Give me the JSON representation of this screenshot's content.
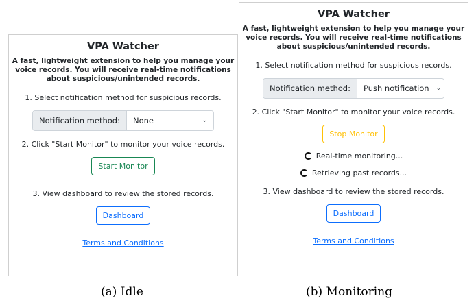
{
  "panels": [
    {
      "title": "VPA Watcher",
      "description": "A fast, lightweight extension to help you manage your voice records. You will receive real-time notifications about suspicious/unintended records.",
      "step1": "1. Select notification method for suspicious records.",
      "select_label": "Notification method:",
      "select_value": "None",
      "step2": "2. Click \"Start Monitor\" to monitor your voice records.",
      "monitor_button": "Start Monitor",
      "step3": "3. View dashboard to review the stored records.",
      "dashboard_button": "Dashboard",
      "terms_link": "Terms and Conditions",
      "caption": "(a) Idle"
    },
    {
      "title": "VPA Watcher",
      "description": "A fast, lightweight extension to help you manage your voice records. You will receive real-time notifications about suspicious/unintended records.",
      "step1": "1. Select notification method for suspicious records.",
      "select_label": "Notification method:",
      "select_value": "Push notification",
      "step2": "2. Click \"Start Monitor\" to monitor your voice records.",
      "monitor_button": "Stop Monitor",
      "status_realtime": "Real-time monitoring...",
      "status_past": "Retrieving past records...",
      "step3": "3. View dashboard to review the stored records.",
      "dashboard_button": "Dashboard",
      "terms_link": "Terms and Conditions",
      "caption": "(b) Monitoring"
    }
  ],
  "colors": {
    "success": "#198754",
    "warning": "#ffc107",
    "primary": "#0d6efd"
  },
  "icons": {
    "select_chevron": "chevron-down-icon",
    "spinner": "spinner-icon"
  }
}
